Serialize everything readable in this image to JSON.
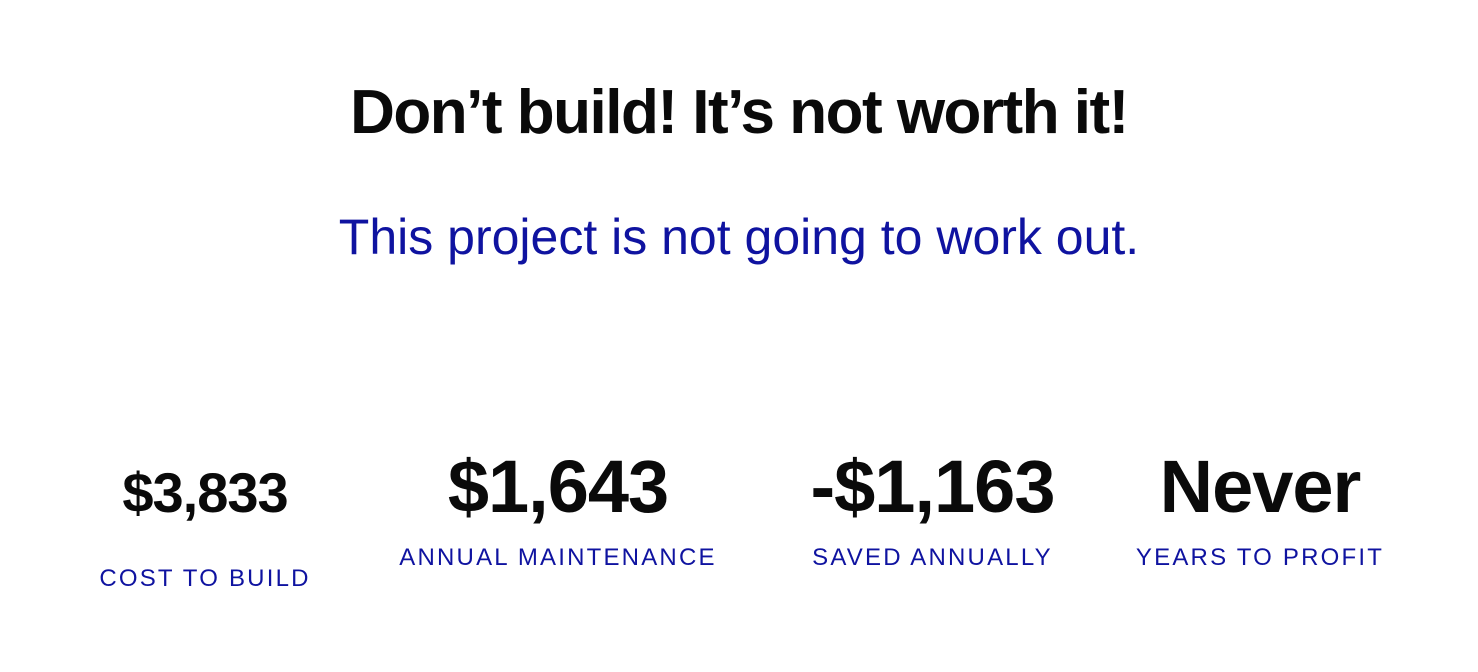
{
  "result": {
    "headline": "Don’t build! It’s not worth it!",
    "subhead": "This project is not going to work out."
  },
  "stats": [
    {
      "value": "$3,833",
      "label": "COST TO BUILD"
    },
    {
      "value": "$1,643",
      "label": "ANNUAL MAINTENANCE"
    },
    {
      "value": "-$1,163",
      "label": "SAVED ANNUALLY"
    },
    {
      "value": "Never",
      "label": "YEARS TO PROFIT"
    }
  ],
  "colors": {
    "headline": "#0a0a0a",
    "accent": "#0f13a0",
    "background": "#ffffff"
  }
}
